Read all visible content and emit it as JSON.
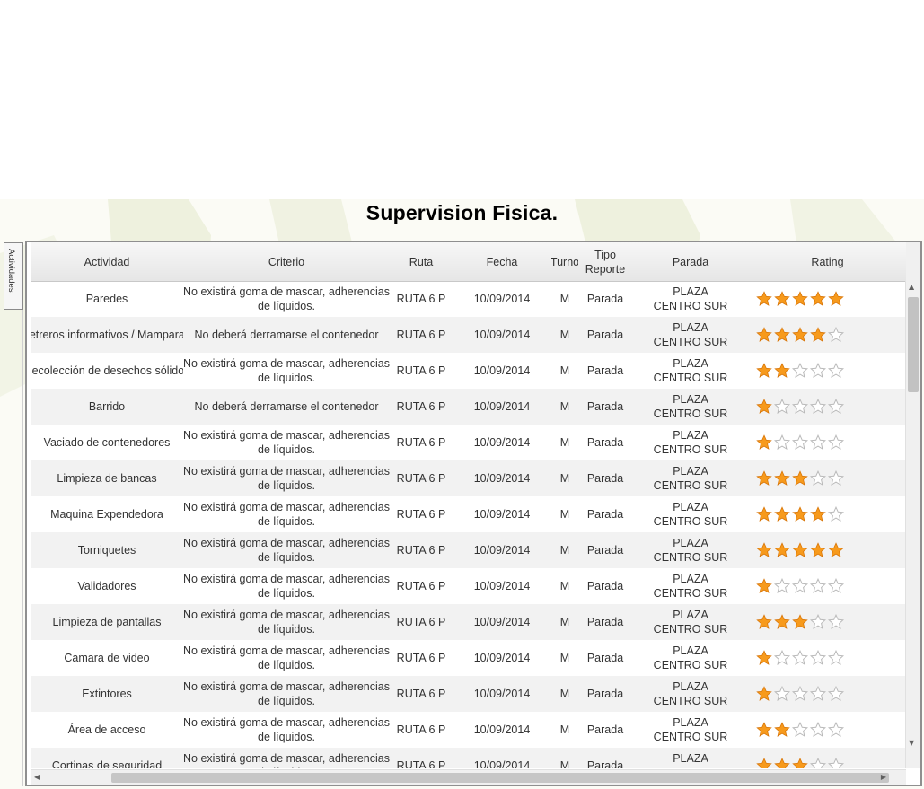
{
  "page_title": "Supervision Fisica.",
  "side_tab_label": "Actividades",
  "colors": {
    "star_fill": "#f79a1c",
    "star_outline": "#b9b9b9",
    "alt_row": "#f2f2f2"
  },
  "columns": {
    "actividad": "Actividad",
    "criterio": "Criterio",
    "ruta": "Ruta",
    "fecha": "Fecha",
    "turno": "Turno",
    "tipo": "Tipo Reporte",
    "parada": "Parada",
    "rating": "Rating"
  },
  "rows": [
    {
      "actividad": "Paredes",
      "criterio": "No existirá goma de mascar, adherencias de líquidos.",
      "ruta": "RUTA 6 P",
      "fecha": "10/09/2014",
      "turno": "M",
      "tipo": "Parada",
      "parada": "PLAZA CENTRO SUR",
      "rating": 5
    },
    {
      "actividad": "Letreros informativos / Mamparas",
      "criterio": "No deberá derramarse el contenedor",
      "ruta": "RUTA 6 P",
      "fecha": "10/09/2014",
      "turno": "M",
      "tipo": "Parada",
      "parada": "PLAZA CENTRO SUR",
      "rating": 4
    },
    {
      "actividad": "Recolección de desechos sólidos",
      "criterio": "No existirá goma de mascar, adherencias de líquidos.",
      "ruta": "RUTA 6 P",
      "fecha": "10/09/2014",
      "turno": "M",
      "tipo": "Parada",
      "parada": "PLAZA CENTRO SUR",
      "rating": 2
    },
    {
      "actividad": "Barrido",
      "criterio": "No deberá derramarse el contenedor",
      "ruta": "RUTA 6 P",
      "fecha": "10/09/2014",
      "turno": "M",
      "tipo": "Parada",
      "parada": "PLAZA CENTRO SUR",
      "rating": 1
    },
    {
      "actividad": "Vaciado de contenedores",
      "criterio": "No existirá goma de mascar, adherencias de líquidos.",
      "ruta": "RUTA 6 P",
      "fecha": "10/09/2014",
      "turno": "M",
      "tipo": "Parada",
      "parada": "PLAZA CENTRO SUR",
      "rating": 1
    },
    {
      "actividad": "Limpieza de bancas",
      "criterio": "No existirá goma de mascar, adherencias de líquidos.",
      "ruta": "RUTA 6 P",
      "fecha": "10/09/2014",
      "turno": "M",
      "tipo": "Parada",
      "parada": "PLAZA CENTRO SUR",
      "rating": 3
    },
    {
      "actividad": "Maquina Expendedora",
      "criterio": "No existirá goma de mascar, adherencias de líquidos.",
      "ruta": "RUTA 6 P",
      "fecha": "10/09/2014",
      "turno": "M",
      "tipo": "Parada",
      "parada": "PLAZA CENTRO SUR",
      "rating": 4
    },
    {
      "actividad": "Torniquetes",
      "criterio": "No existirá goma de mascar, adherencias de líquidos.",
      "ruta": "RUTA 6 P",
      "fecha": "10/09/2014",
      "turno": "M",
      "tipo": "Parada",
      "parada": "PLAZA CENTRO SUR",
      "rating": 5
    },
    {
      "actividad": "Validadores",
      "criterio": "No existirá goma de mascar, adherencias de líquidos.",
      "ruta": "RUTA 6 P",
      "fecha": "10/09/2014",
      "turno": "M",
      "tipo": "Parada",
      "parada": "PLAZA CENTRO SUR",
      "rating": 1
    },
    {
      "actividad": "Limpieza de pantallas",
      "criterio": "No existirá goma de mascar, adherencias de líquidos.",
      "ruta": "RUTA 6 P",
      "fecha": "10/09/2014",
      "turno": "M",
      "tipo": "Parada",
      "parada": "PLAZA CENTRO SUR",
      "rating": 3
    },
    {
      "actividad": "Camara de video",
      "criterio": "No existirá goma de mascar, adherencias de líquidos.",
      "ruta": "RUTA 6 P",
      "fecha": "10/09/2014",
      "turno": "M",
      "tipo": "Parada",
      "parada": "PLAZA CENTRO SUR",
      "rating": 1
    },
    {
      "actividad": "Extintores",
      "criterio": "No existirá goma de mascar, adherencias de líquidos.",
      "ruta": "RUTA 6 P",
      "fecha": "10/09/2014",
      "turno": "M",
      "tipo": "Parada",
      "parada": "PLAZA CENTRO SUR",
      "rating": 1
    },
    {
      "actividad": "Área de acceso",
      "criterio": "No existirá goma de mascar, adherencias de líquidos.",
      "ruta": "RUTA 6 P",
      "fecha": "10/09/2014",
      "turno": "M",
      "tipo": "Parada",
      "parada": "PLAZA CENTRO SUR",
      "rating": 2
    },
    {
      "actividad": "Cortinas de seguridad",
      "criterio": "No existirá goma de mascar, adherencias de líquidos.",
      "ruta": "RUTA 6 P",
      "fecha": "10/09/2014",
      "turno": "M",
      "tipo": "Parada",
      "parada": "PLAZA CENTRO SUR",
      "rating": 3
    }
  ]
}
